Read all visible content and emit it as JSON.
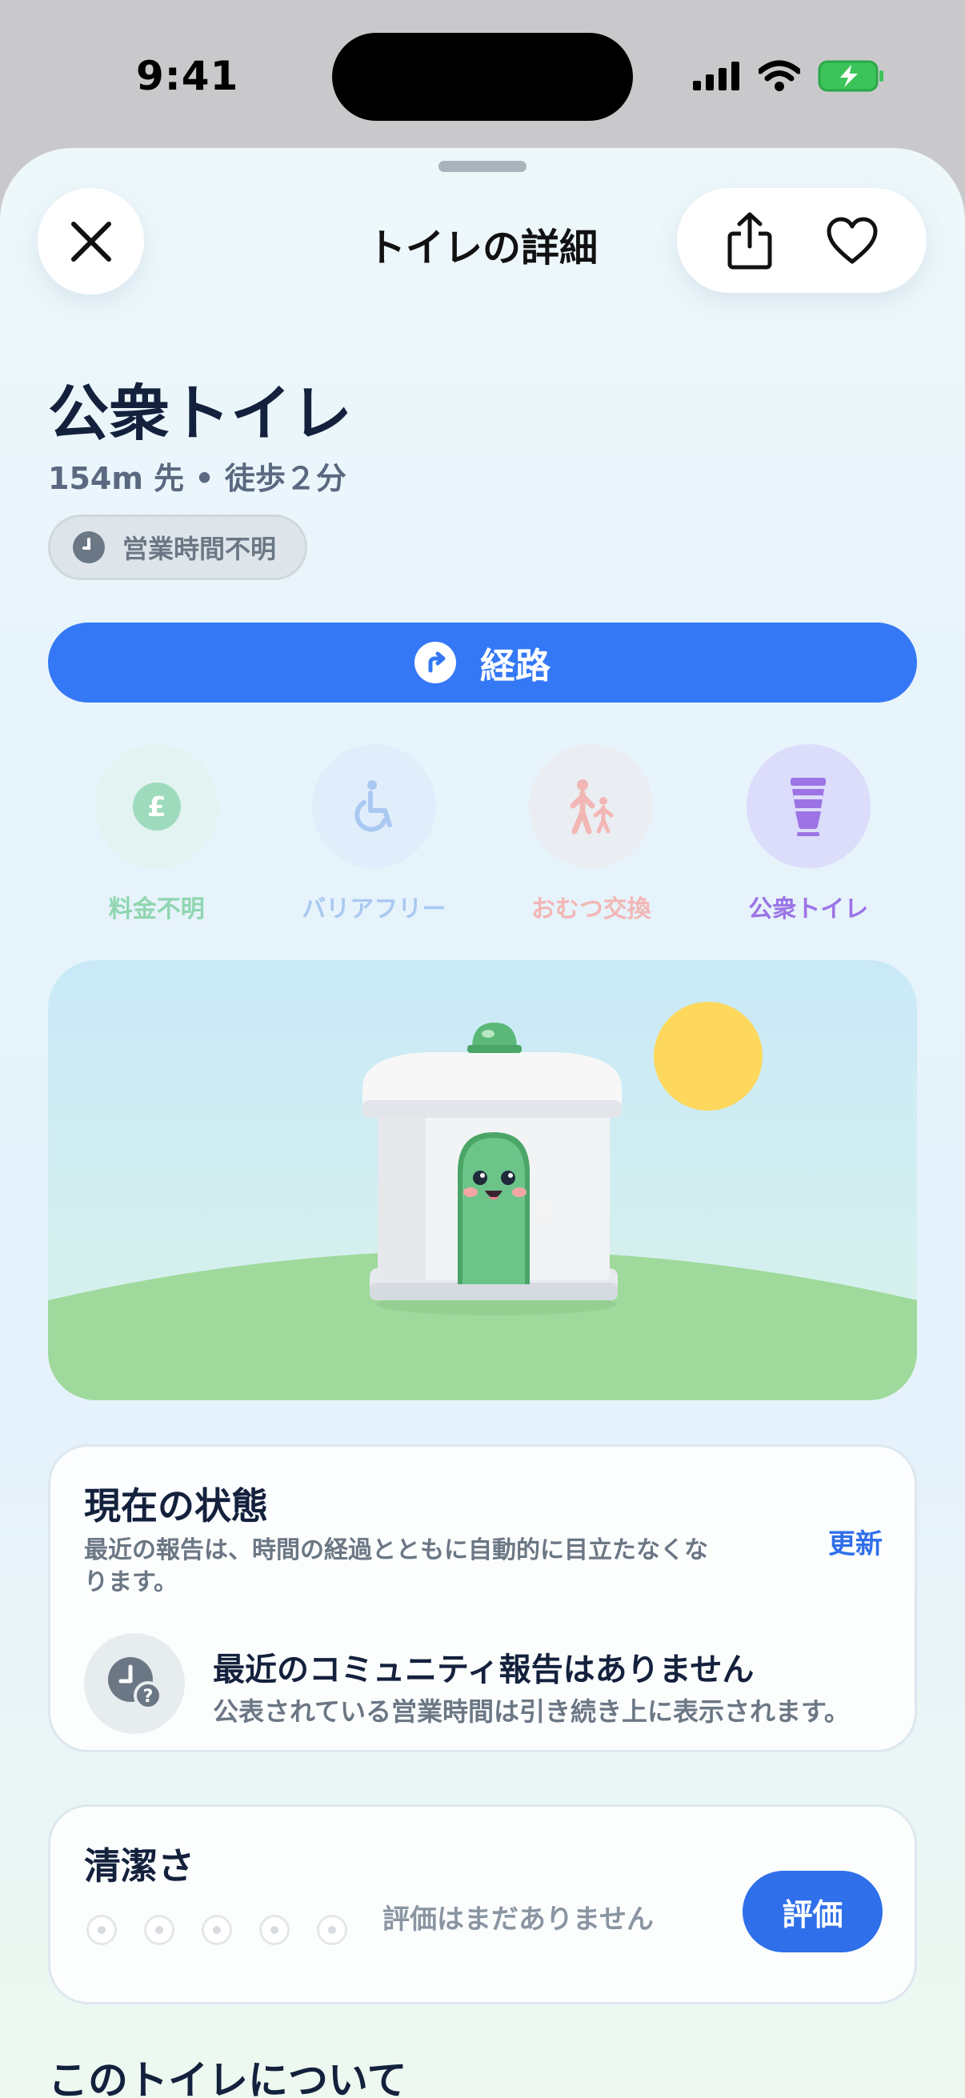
{
  "status_bar": {
    "time": "9:41"
  },
  "header": {
    "title": "トイレの詳細"
  },
  "place": {
    "name": "公衆トイレ",
    "distance_walk": "154m 先 • 徒歩２分",
    "hours_badge": "営業時間不明"
  },
  "route_button": {
    "label": "経路"
  },
  "features": [
    {
      "label": "料金不明",
      "icon": "pound-coin-icon",
      "color": "#8fd6b0",
      "bg": "#e3f3f1"
    },
    {
      "label": "バリアフリー",
      "icon": "wheelchair-icon",
      "color": "#a9c9f2",
      "bg": "#e0eefb"
    },
    {
      "label": "おむつ交換",
      "icon": "family-icon",
      "color": "#f2b7b4",
      "bg": "#eaeef2"
    },
    {
      "label": "公衆トイレ",
      "icon": "toilet-icon",
      "color": "#9c74e6",
      "bg": "#dcdcfb"
    }
  ],
  "status_card": {
    "title": "現在の状態",
    "description": "最近の報告は、時間の経過とともに自動的に目立たなくなります。",
    "refresh_label": "更新",
    "report_title": "最近のコミュニティ報告はありません",
    "report_subtitle": "公表されている営業時間は引き続き上に表示されます。"
  },
  "cleanliness_card": {
    "title": "清潔さ",
    "rating_count": 5,
    "no_rating_text": "評価はまだありません",
    "rate_button": "評価"
  },
  "about": {
    "title": "このトイレについて"
  },
  "colors": {
    "accent": "#3478f6",
    "title_text": "#14213d",
    "muted_text": "#6b7784"
  }
}
